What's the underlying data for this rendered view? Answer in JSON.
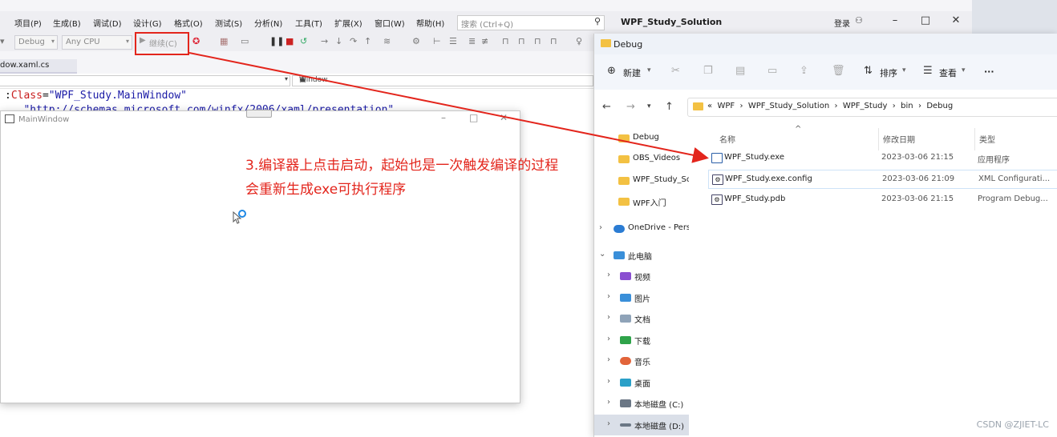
{
  "vs": {
    "menu": [
      "项目(P)",
      "生成(B)",
      "调试(D)",
      "设计(G)",
      "格式(O)",
      "测试(S)",
      "分析(N)",
      "工具(T)",
      "扩展(X)",
      "窗口(W)",
      "帮助(H)"
    ],
    "search_placeholder": "搜索 (Ctrl+Q)",
    "solution_title": "WPF_Study_Solution",
    "login": "登录",
    "toolbar": {
      "config": "Debug",
      "platform": "Any CPU",
      "continue": "继续(C)"
    },
    "tab": "dow.xaml.cs",
    "nav_type": "Window",
    "code_line1_prefix": ":",
    "code_line1_attr": "Class",
    "code_line1_eq": "=",
    "code_line1_value": "\"WPF_Study.MainWindow\"",
    "code_line2": "   \"http://schemas.microsoft.com/winfx/2006/xaml/presentation\""
  },
  "mainwindow": {
    "title": "MainWindow"
  },
  "annotation": {
    "line1": "3.编译器上点击启动，起始也是一次触发编译的过程",
    "line2": "会重新生成exe可执行程序",
    "color": "#e3251c"
  },
  "explorer": {
    "title": "Debug",
    "commands": {
      "new": "新建",
      "sort": "排序",
      "view": "查看",
      "more": "···"
    },
    "address": [
      "WPF",
      "WPF_Study_Solution",
      "WPF_Study",
      "bin",
      "Debug"
    ],
    "nav": [
      {
        "label": "Debug"
      },
      {
        "label": "OBS_Videos"
      },
      {
        "label": "WPF_Study_Sc"
      },
      {
        "label": "WPF入门"
      },
      {
        "label": "OneDrive - Pers"
      },
      {
        "label": "此电脑"
      },
      {
        "label": "视频"
      },
      {
        "label": "图片"
      },
      {
        "label": "文档"
      },
      {
        "label": "下载"
      },
      {
        "label": "音乐"
      },
      {
        "label": "桌面"
      },
      {
        "label": "本地磁盘 (C:)"
      },
      {
        "label": "本地磁盘 (D:)"
      }
    ],
    "columns": {
      "name": "名称",
      "date": "修改日期",
      "type": "类型"
    },
    "files": [
      {
        "name": "WPF_Study.exe",
        "date": "2023-03-06 21:15",
        "type": "应用程序"
      },
      {
        "name": "WPF_Study.exe.config",
        "date": "2023-03-06 21:09",
        "type": "XML Configurati..."
      },
      {
        "name": "WPF_Study.pdb",
        "date": "2023-03-06 21:15",
        "type": "Program Debug..."
      }
    ]
  },
  "watermark": "CSDN @ZJIET-LC"
}
